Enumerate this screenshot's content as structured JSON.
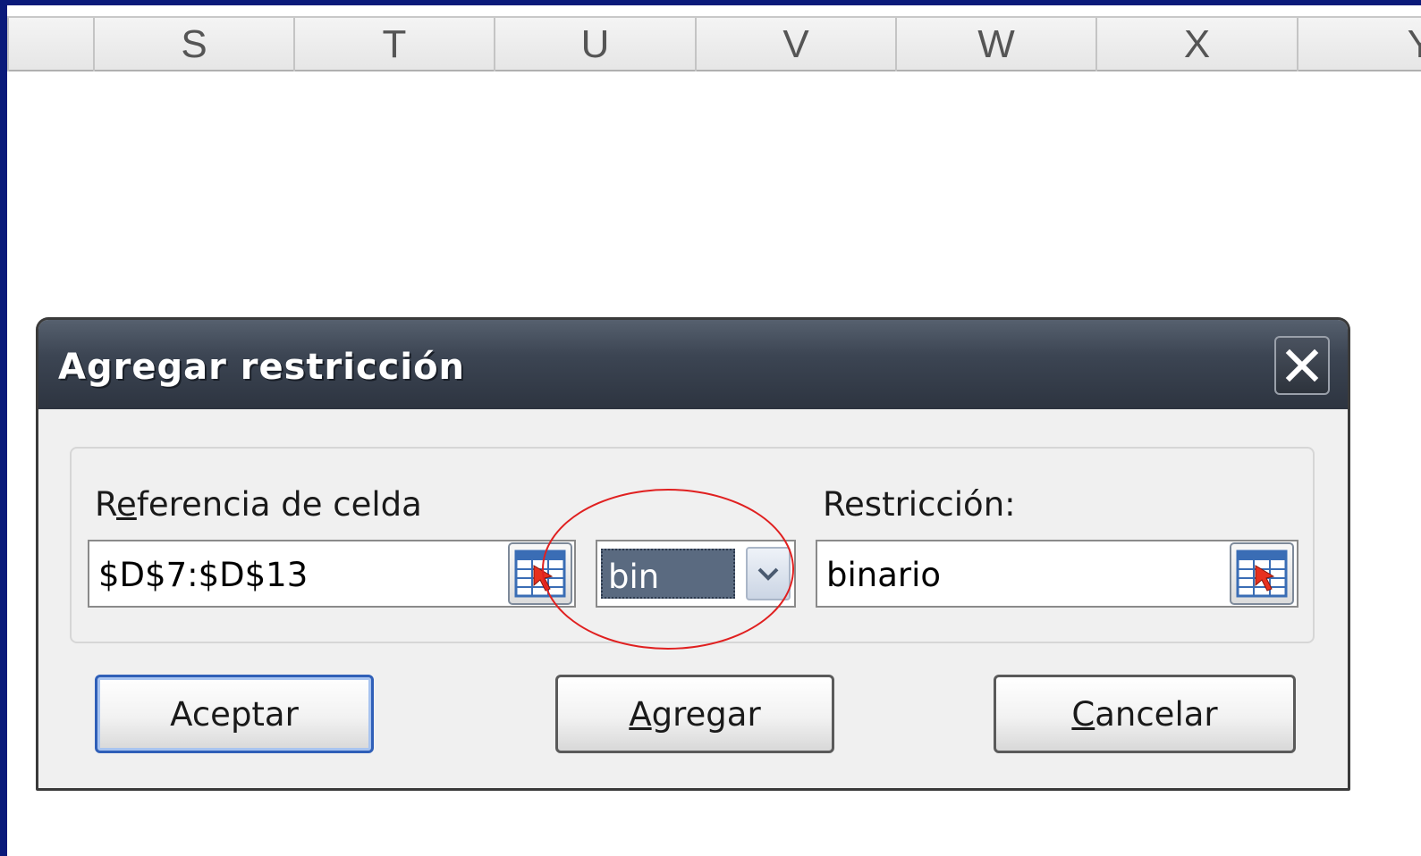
{
  "spreadsheet": {
    "column_headers": [
      "S",
      "T",
      "U",
      "V",
      "W",
      "X",
      "Y"
    ]
  },
  "dialog": {
    "title": "Agregar restricción",
    "close_icon": "close-x-icon",
    "cell_reference": {
      "label_pre": "R",
      "label_accel": "e",
      "label_post": "ferencia de celda",
      "value": "$D$7:$D$13"
    },
    "operator": {
      "selected": "bin"
    },
    "constraint": {
      "label": "Restricción:",
      "value": "binario"
    },
    "buttons": {
      "accept": "Aceptar",
      "add_accel": "A",
      "add_rest": "gregar",
      "cancel_accel": "C",
      "cancel_rest": "ancelar"
    }
  },
  "colors": {
    "annotation": "#e02020",
    "titlebar": "#3c4553",
    "default_button_border": "#2f5fb8"
  }
}
